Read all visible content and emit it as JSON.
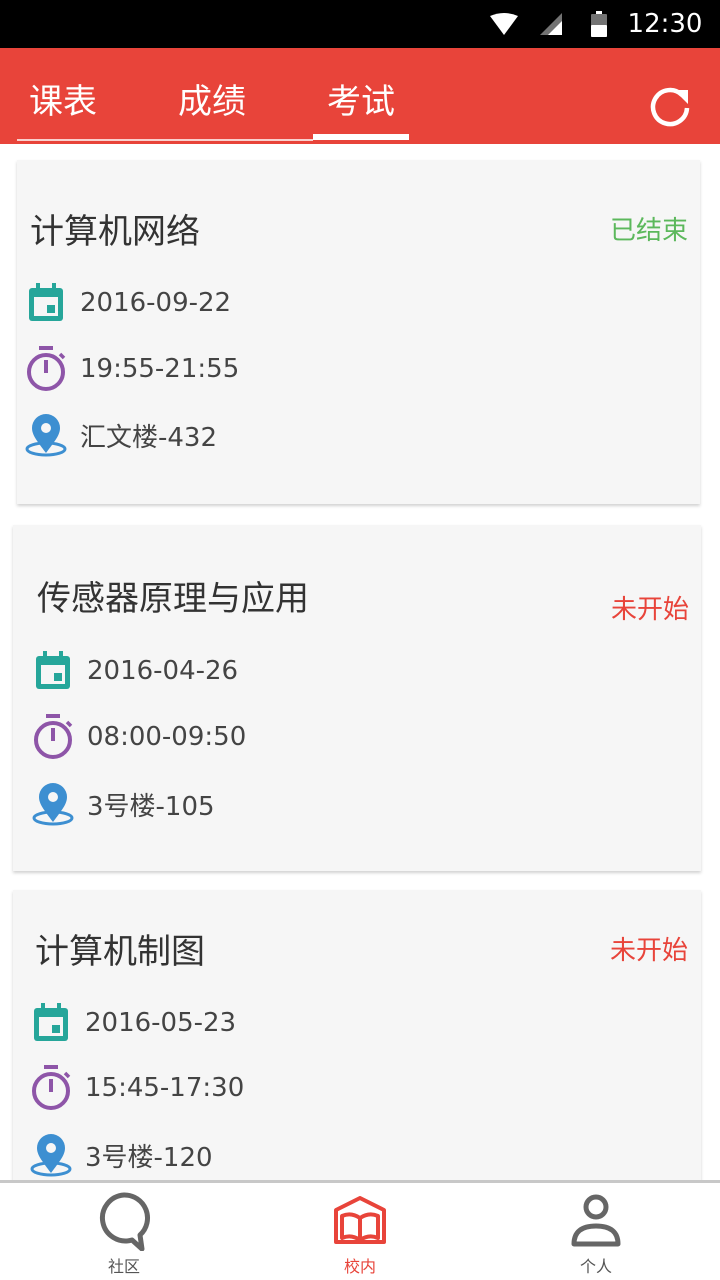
{
  "status_bar": {
    "time": "12:30"
  },
  "header": {
    "tabs": [
      {
        "label": "课表"
      },
      {
        "label": "成绩"
      },
      {
        "label": "考试"
      }
    ],
    "active_tab": "考试"
  },
  "exams": [
    {
      "name": "计算机网络",
      "status": "已结束",
      "status_color": "#5cb85c",
      "date": "2016-09-22",
      "time": "19:55-21:55",
      "location": "汇文楼-432"
    },
    {
      "name": "传感器原理与应用",
      "status": "未开始",
      "status_color": "#e8443a",
      "date": "2016-04-26",
      "time": "08:00-09:50",
      "location": "3号楼-105"
    },
    {
      "name": "计算机制图",
      "status": "未开始",
      "status_color": "#e8443a",
      "date": "2016-05-23",
      "time": "15:45-17:30",
      "location": "3号楼-120"
    }
  ],
  "bottom_nav": {
    "items": [
      {
        "label": "社区"
      },
      {
        "label": "校内"
      },
      {
        "label": "个人"
      }
    ],
    "active": "校内"
  },
  "colors": {
    "brand": "#e8443a",
    "date_icon": "#26a69a",
    "time_icon": "#8e55a8",
    "location_icon": "#3d8fd1"
  }
}
